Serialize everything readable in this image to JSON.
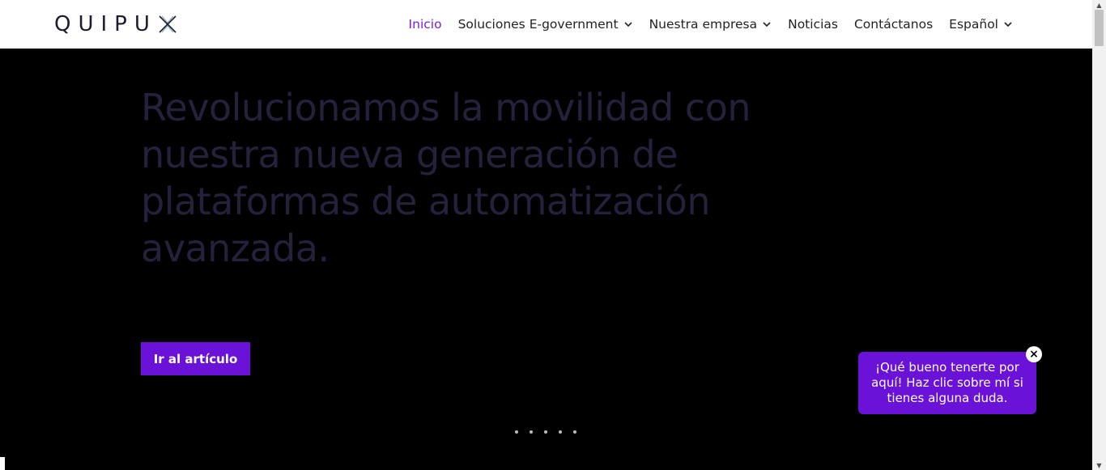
{
  "brand": {
    "logo_text": "QUIPU",
    "accent": "#6a12d8",
    "nav_active": "#7a1fd6"
  },
  "nav": {
    "items": [
      {
        "label": "Inicio",
        "active": true,
        "dropdown": false
      },
      {
        "label": "Soluciones E-government",
        "active": false,
        "dropdown": true
      },
      {
        "label": "Nuestra empresa",
        "active": false,
        "dropdown": true
      },
      {
        "label": "Noticias",
        "active": false,
        "dropdown": false
      },
      {
        "label": "Contáctanos",
        "active": false,
        "dropdown": false
      },
      {
        "label": "Español",
        "active": false,
        "dropdown": true
      }
    ]
  },
  "hero": {
    "headline": "Revolucionamos la movilidad con nuestra nueva generación de plataformas de automatización avanzada.",
    "cta_label": "Ir al artículo",
    "slide_count": 5
  },
  "chat": {
    "message": "¡Qué bueno tenerte por aquí! Haz clic sobre mí si tienes alguna duda.",
    "close_label": "×"
  },
  "scrollbar": {
    "up_arrow": "▲",
    "down_arrow": "▼"
  }
}
